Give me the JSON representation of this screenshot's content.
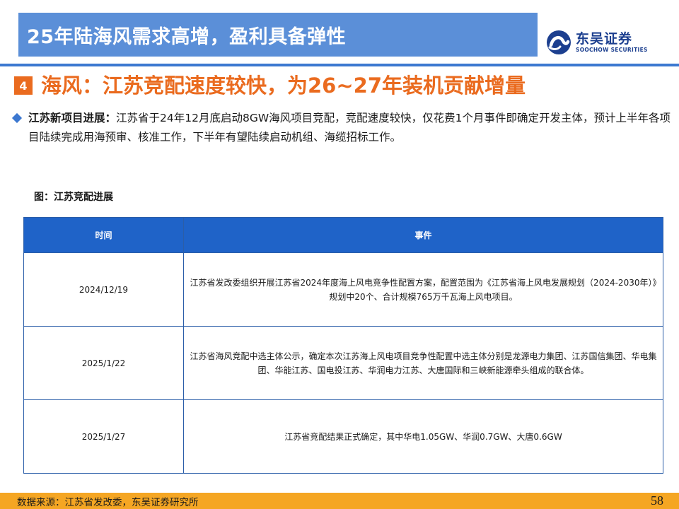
{
  "header": {
    "title": "25年陆海风需求高增，盈利具备弹性",
    "logo": {
      "name_cn": "东吴证券",
      "name_en": "SOOCHOW SECURITIES",
      "icon": "soochow-logo-icon"
    }
  },
  "section": {
    "number": "4",
    "title": "海风：江苏竞配速度较快，为26~27年装机贡献增量"
  },
  "bullet": {
    "icon": "diamond-bullet-icon",
    "lead": "江苏新项目进展：",
    "text": "江苏省于24年12月底启动8GW海风项目竞配，竞配速度较快，仅花费1个月事件即确定开发主体，预计上半年各项目陆续完成用海预审、核准工作，下半年有望陆续启动机组、海缆招标工作。"
  },
  "figure": {
    "caption": "图：江苏竞配进展",
    "columns": [
      "时间",
      "事件"
    ],
    "rows": [
      {
        "date": "2024/12/19",
        "event": "江苏省发改委组织开展江苏省2024年度海上风电竞争性配置方案，配置范围为《江苏省海上风电发展规划（2024-2030年）》规划中20个、合计规模765万千瓦海上风电项目。"
      },
      {
        "date": "2025/1/22",
        "event": "江苏省海风竞配中选主体公示，确定本次江苏海上风电项目竞争性配置中选主体分别是龙源电力集团、江苏国信集团、华电集团、华能江苏、国电投江苏、华润电力江苏、大唐国际和三峡新能源牵头组成的联合体。"
      },
      {
        "date": "2025/1/27",
        "event": "江苏省竞配结果正式确定，其中华电1.05GW、华润0.7GW、大唐0.6GW"
      }
    ]
  },
  "footer": {
    "source": "数据来源：江苏省发改委，东吴证券研究所",
    "page": "58"
  },
  "colors": {
    "title_bar": "#5b8fd8",
    "accent_orange": "#ea6b1f",
    "table_header": "#1f63c8",
    "footer_bar": "#f5a623",
    "brand_blue": "#1c3f8f"
  }
}
